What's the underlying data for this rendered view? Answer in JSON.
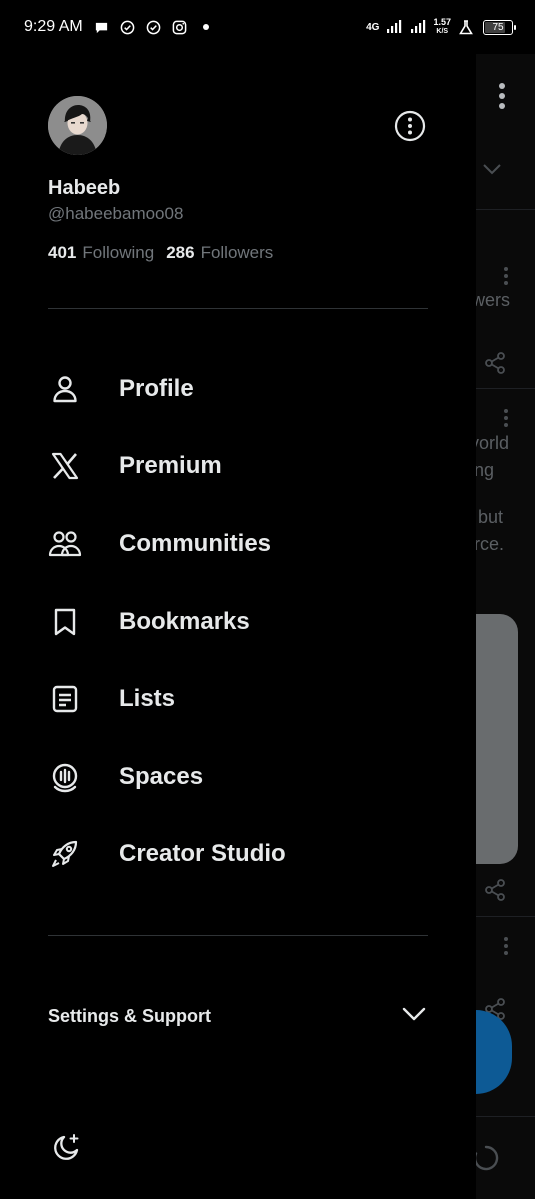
{
  "status_bar": {
    "time": "9:29 AM",
    "network": "4G",
    "speed_value": "1.57",
    "speed_unit": "K/S",
    "battery": "75",
    "notification_icons": [
      "chat-bubble-icon",
      "check-circle-icon",
      "check-circle-icon",
      "instagram-icon",
      "dot-icon"
    ]
  },
  "profile": {
    "name": "Habeeb",
    "handle": "@habeebamoo08",
    "following_count": "401",
    "following_label": "Following",
    "followers_count": "286",
    "followers_label": "Followers"
  },
  "menu": {
    "items": [
      {
        "label": "Profile",
        "icon": "person-icon"
      },
      {
        "label": "Premium",
        "icon": "x-logo-icon"
      },
      {
        "label": "Communities",
        "icon": "communities-icon"
      },
      {
        "label": "Bookmarks",
        "icon": "bookmark-icon"
      },
      {
        "label": "Lists",
        "icon": "list-icon"
      },
      {
        "label": "Spaces",
        "icon": "spaces-icon"
      },
      {
        "label": "Creator Studio",
        "icon": "rocket-icon"
      }
    ]
  },
  "settings": {
    "label": "Settings & Support"
  },
  "background_feed": {
    "fragments": [
      "wers",
      "vorld",
      "ng",
      "but",
      "rce."
    ]
  },
  "colors": {
    "background": "#000000",
    "primary_text": "#e7e9ea",
    "secondary_text": "#71767b",
    "divider": "#2f3336",
    "accent": "#1d9bf0"
  }
}
